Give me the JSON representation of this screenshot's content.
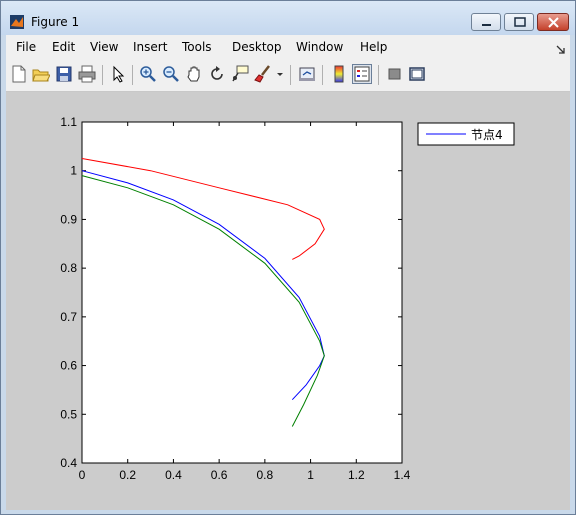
{
  "window": {
    "title": "Figure 1"
  },
  "menu": [
    "File",
    "Edit",
    "View",
    "Insert",
    "Tools",
    "Desktop",
    "Window",
    "Help"
  ],
  "toolbar": {
    "icons": [
      "new-figure-icon",
      "open-file-icon",
      "save-icon",
      "print-icon",
      "pointer-icon",
      "zoom-in-icon",
      "zoom-out-icon",
      "pan-icon",
      "rotate-icon",
      "data-cursor-icon",
      "brush-icon",
      "link-plot-icon",
      "colorbar-icon",
      "legend-icon",
      "hide-tools-icon",
      "show-tools-icon"
    ]
  },
  "chart_data": {
    "type": "line",
    "xlim": [
      0,
      1.4
    ],
    "ylim": [
      0.4,
      1.1
    ],
    "x_ticks": [
      "0",
      "0.2",
      "0.4",
      "0.6",
      "0.8",
      "1",
      "1.2",
      "1.4"
    ],
    "y_ticks": [
      "0.4",
      "0.5",
      "0.6",
      "0.7",
      "0.8",
      "0.9",
      "1",
      "1.1"
    ],
    "grid": false,
    "legend": {
      "placement": "outside-top-right",
      "entries": [
        "节点4"
      ]
    },
    "series": [
      {
        "name": "节点4",
        "color": "#0000ff",
        "points": [
          [
            0,
            1.0
          ],
          [
            0.2,
            0.975
          ],
          [
            0.4,
            0.94
          ],
          [
            0.6,
            0.89
          ],
          [
            0.8,
            0.82
          ],
          [
            0.95,
            0.74
          ],
          [
            1.04,
            0.66
          ],
          [
            1.06,
            0.62
          ],
          [
            1.04,
            0.6
          ],
          [
            0.98,
            0.56
          ],
          [
            0.92,
            0.53
          ]
        ]
      },
      {
        "color": "#ff0000",
        "points": [
          [
            0,
            1.025
          ],
          [
            0.3,
            1.0
          ],
          [
            0.6,
            0.965
          ],
          [
            0.9,
            0.93
          ],
          [
            1.04,
            0.9
          ],
          [
            1.06,
            0.88
          ],
          [
            1.02,
            0.85
          ],
          [
            0.95,
            0.825
          ],
          [
            0.92,
            0.818
          ]
        ]
      },
      {
        "color": "#008000",
        "points": [
          [
            0,
            0.99
          ],
          [
            0.2,
            0.965
          ],
          [
            0.4,
            0.93
          ],
          [
            0.6,
            0.88
          ],
          [
            0.8,
            0.81
          ],
          [
            0.95,
            0.73
          ],
          [
            1.04,
            0.65
          ],
          [
            1.06,
            0.62
          ],
          [
            1.03,
            0.58
          ],
          [
            0.97,
            0.52
          ],
          [
            0.92,
            0.475
          ]
        ]
      }
    ]
  }
}
